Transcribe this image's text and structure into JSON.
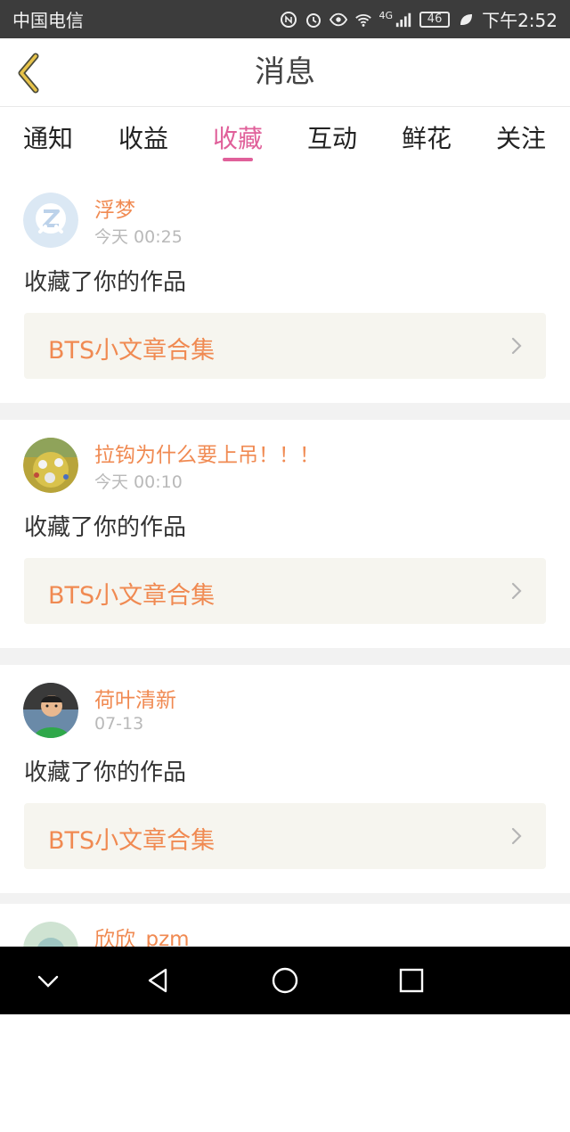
{
  "status_bar": {
    "carrier": "中国电信",
    "network": "4G",
    "battery": "46",
    "time": "下午2:52"
  },
  "header": {
    "title": "消息",
    "back_icon": "chevron-left-icon"
  },
  "tabs": [
    {
      "label": "通知",
      "active": false
    },
    {
      "label": "收益",
      "active": false
    },
    {
      "label": "收藏",
      "active": true
    },
    {
      "label": "互动",
      "active": false
    },
    {
      "label": "鲜花",
      "active": false
    },
    {
      "label": "关注",
      "active": false
    }
  ],
  "messages": [
    {
      "user": "浮梦",
      "time": "今天 00:25",
      "action": "收藏了你的作品",
      "work": "BTS小文章合集",
      "avatar": "default-avatar"
    },
    {
      "user": "拉钩为什么要上吊！！！",
      "time": "今天 00:10",
      "action": "收藏了你的作品",
      "work": "BTS小文章合集",
      "avatar": "game-avatar"
    },
    {
      "user": "荷叶清新",
      "time": "07-13",
      "action": "收藏了你的作品",
      "work": "BTS小文章合集",
      "avatar": "boy-photo-avatar"
    },
    {
      "user": "欣欣_pzm",
      "time": "",
      "action": "",
      "work": "",
      "avatar": "photo-avatar"
    }
  ],
  "colors": {
    "accent_pink": "#e0609a",
    "username_orange": "#f08a52",
    "work_bg": "#f6f5ef"
  }
}
